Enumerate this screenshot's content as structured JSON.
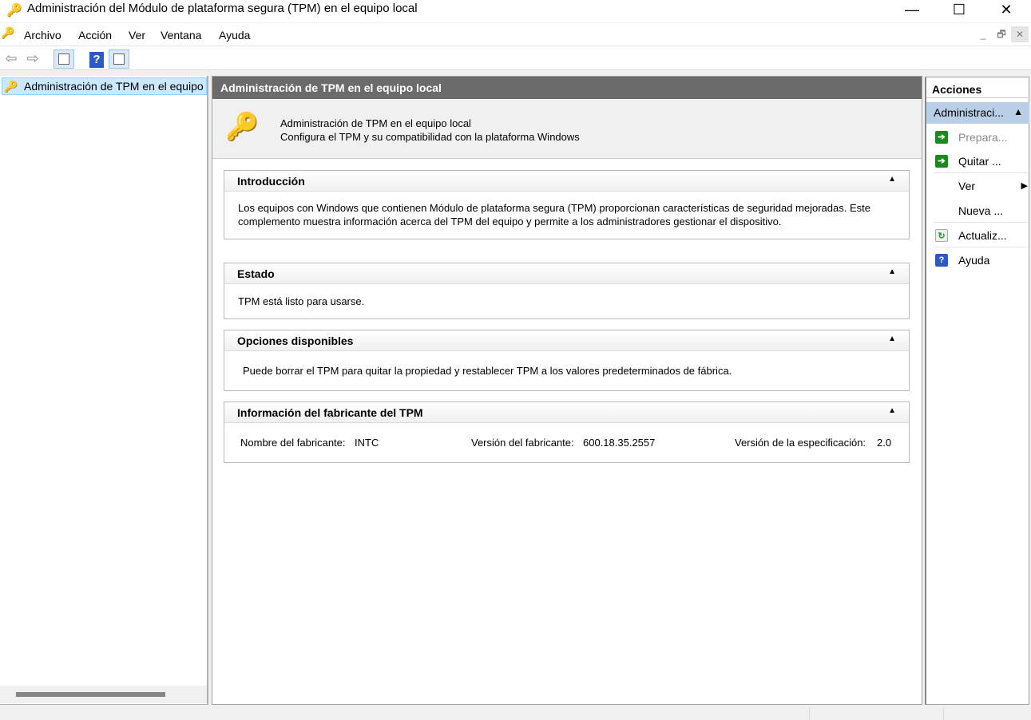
{
  "window": {
    "title": "Administración del Módulo de plataforma segura (TPM) en el equipo local",
    "minimize": "—",
    "maximize": "☐",
    "close": "✕"
  },
  "menu": {
    "items": [
      "Archivo",
      "Acción",
      "Ver",
      "Ventana",
      "Ayuda"
    ],
    "mdi_min": "_",
    "mdi_restore": "🗗",
    "mdi_close": "✕"
  },
  "toolbar": {
    "back": "⇦",
    "forward": "⇨",
    "help": "?"
  },
  "tree": {
    "item": "Administración de TPM en el equipo local"
  },
  "center": {
    "header": "Administración de TPM en el equipo local",
    "intro_line1": "Administración de TPM en el equipo local",
    "intro_line2": "Configura el TPM y su compatibilidad con la plataforma Windows",
    "sections": [
      {
        "title": "Introducción",
        "body": "Los equipos con Windows que contienen Módulo de plataforma segura (TPM) proporcionan características de seguridad mejoradas. Este complemento muestra información acerca del TPM del equipo y permite a los administradores gestionar el dispositivo."
      },
      {
        "title": "Estado",
        "body": "TPM está listo para usarse."
      },
      {
        "title": "Opciones disponibles",
        "body": "Puede borrar el TPM para quitar la propiedad y restablecer TPM a los valores predeterminados de fábrica."
      },
      {
        "title": "Información del fabricante del TPM",
        "manufacturer_label": "Nombre del fabricante:",
        "manufacturer": "INTC",
        "version_label": "Versión del fabricante:",
        "version": "600.18.35.2557",
        "spec_label": "Versión de la especificación:",
        "spec": "2.0"
      }
    ],
    "collapse": "▲"
  },
  "actions": {
    "header": "Acciones",
    "group": "Administraci...",
    "items": [
      {
        "label": "Prepara...",
        "icon": "green-arrow-icon",
        "disabled": true
      },
      {
        "label": "Quitar ...",
        "icon": "green-arrow-icon"
      },
      {
        "label": "Ver",
        "submenu": "▶"
      },
      {
        "label": "Nueva ..."
      },
      {
        "label": "Actualiz...",
        "icon": "refresh-icon"
      },
      {
        "label": "Ayuda",
        "icon": "help-icon"
      }
    ]
  },
  "colors": {
    "header_bg": "#6b6b6b",
    "selected": "#b8cfe7",
    "action_icon": "#1a8a1a"
  }
}
